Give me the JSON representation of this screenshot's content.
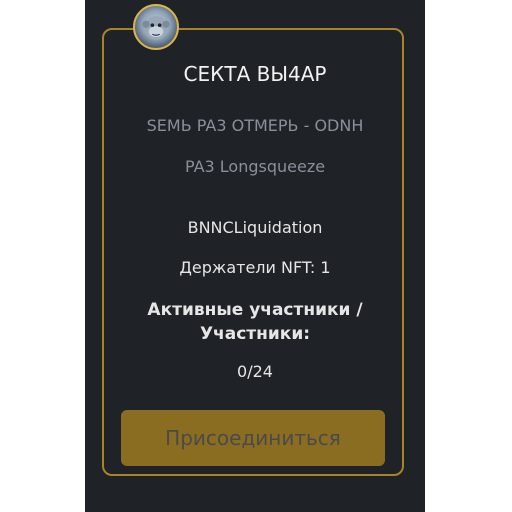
{
  "group": {
    "title": "СЕКТА ВЫ4АР",
    "subtitle_line1": "SEMЬ PA3 OTMEPЬ - ODNH",
    "subtitle_line2": "PA3 Longsqueeze",
    "name": "BNNCLiquidation",
    "nft_holders": "Держатели NFT: 1",
    "participants_label_line1": "Активные участники /",
    "participants_label_line2": "Участники:",
    "participants_count": "0/24",
    "join_label": "Присоединиться"
  },
  "colors": {
    "background": "#1f2227",
    "border_gold": "#a98426",
    "button_gold": "#8a6d20"
  }
}
